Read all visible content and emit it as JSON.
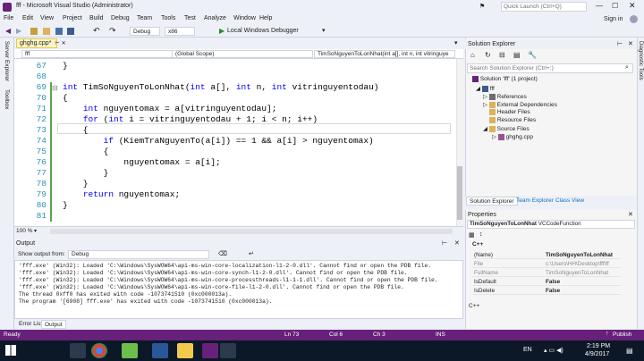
{
  "window": {
    "title": "fff - Microsoft Visual Studio (Administrator)",
    "quick_launch_placeholder": "Quick Launch (Ctrl+Q)",
    "sign_in": "Sign in"
  },
  "menu": [
    "File",
    "Edit",
    "View",
    "Project",
    "Build",
    "Debug",
    "Team",
    "Tools",
    "Test",
    "Analyze",
    "Window",
    "Help"
  ],
  "toolbar": {
    "config": "Debug",
    "platform": "x86",
    "run_label": "Local Windows Debugger"
  },
  "left_strip": {
    "server_explorer": "Server Explorer",
    "toolbox": "Toolbox"
  },
  "right_strip": {
    "diagnostic_tools": "Diagnostic Tools"
  },
  "editor": {
    "tab_label": "ghghg.cpp*",
    "nav": {
      "project": "fff",
      "scope": "(Global Scope)",
      "function": "TimSoNguyenToLonNhat(int a[], int n, int vitringuye"
    },
    "lines": [
      {
        "num": "67",
        "text": "}"
      },
      {
        "num": "68",
        "text": ""
      },
      {
        "num": "69",
        "text": "int TimSoNguyenToLonNhat(int a[], int n, int vitringuyentodau)"
      },
      {
        "num": "70",
        "text": "{"
      },
      {
        "num": "71",
        "text": "    int nguyentomax = a[vitringuyentodau];"
      },
      {
        "num": "72",
        "text": "    for (int i = vitringuyentodau + 1; i < n; i++)"
      },
      {
        "num": "73",
        "text": "    {"
      },
      {
        "num": "74",
        "text": "        if (KiemTraNguyenTo(a[i]) == 1 && a[i] > nguyentomax)"
      },
      {
        "num": "75",
        "text": "        {"
      },
      {
        "num": "76",
        "text": "            nguyentomax = a[i];"
      },
      {
        "num": "77",
        "text": "        }"
      },
      {
        "num": "78",
        "text": "    }"
      },
      {
        "num": "79",
        "text": "    return nguyentomax;"
      },
      {
        "num": "80",
        "text": "}"
      },
      {
        "num": "81",
        "text": ""
      }
    ],
    "zoom": "100 %"
  },
  "output": {
    "title": "Output",
    "show_from_label": "Show output from:",
    "show_from_value": "Debug",
    "lines": [
      "'fff.exe' (Win32): Loaded 'C:\\Windows\\SysWOW64\\api-ms-win-core-localization-l1-2-0.dll'. Cannot find or open the PDB file.",
      "'fff.exe' (Win32): Loaded 'C:\\Windows\\SysWOW64\\api-ms-win-core-synch-l1-2-0.dll'. Cannot find or open the PDB file.",
      "'fff.exe' (Win32): Loaded 'C:\\Windows\\SysWOW64\\api-ms-win-core-processthreads-l1-1-1.dll'. Cannot find or open the PDB file.",
      "'fff.exe' (Win32): Loaded 'C:\\Windows\\SysWOW64\\api-ms-win-core-file-l1-2-0.dll'. Cannot find or open the PDB file.",
      "The thread 0xff0 has exited with code -1073741510 (0xc000013a).",
      "The program '[6908] fff.exe' has exited with code -1073741510 (0xc000013a)."
    ],
    "tabs": [
      "Error List",
      "Output"
    ]
  },
  "solution_explorer": {
    "title": "Solution Explorer",
    "search_placeholder": "Search Solution Explorer (Ctrl+;)",
    "items": [
      {
        "label": "Solution 'fff' (1 project)",
        "depth": 0
      },
      {
        "label": "fff",
        "depth": 1
      },
      {
        "label": "References",
        "depth": 2
      },
      {
        "label": "External Dependencies",
        "depth": 2
      },
      {
        "label": "Header Files",
        "depth": 2
      },
      {
        "label": "Resource Files",
        "depth": 2
      },
      {
        "label": "Source Files",
        "depth": 2
      },
      {
        "label": "ghghg.cpp",
        "depth": 3
      }
    ],
    "tabs": [
      "Solution Explorer",
      "Team Explorer",
      "Class View"
    ]
  },
  "properties": {
    "title": "Properties",
    "object": "TimSoNguyenToLonNhat",
    "object_type": "VCCodeFunction",
    "category": "C++",
    "rows": [
      {
        "name": "(Name)",
        "value": "TimSoNguyenToLonNhat"
      },
      {
        "name": "File",
        "value": "c:\\Users\\HH\\Desktop\\fff\\ff"
      },
      {
        "name": "FullName",
        "value": "TimSoNguyenToLonNhat"
      },
      {
        "name": "IsDefault",
        "value": "False"
      },
      {
        "name": "IsDelete",
        "value": "False"
      }
    ],
    "description": "C++"
  },
  "status": {
    "ready": "Ready",
    "line": "Ln 73",
    "col": "Col 6",
    "ch": "Ch 3",
    "mode": "INS",
    "publish": "Publish"
  },
  "taskbar": {
    "lang": "EN",
    "time": "2:19 PM",
    "date": "4/9/2017"
  },
  "colors": {
    "accent": "#68217a",
    "keyword": "#0000ff",
    "line_number": "#2b91af"
  }
}
